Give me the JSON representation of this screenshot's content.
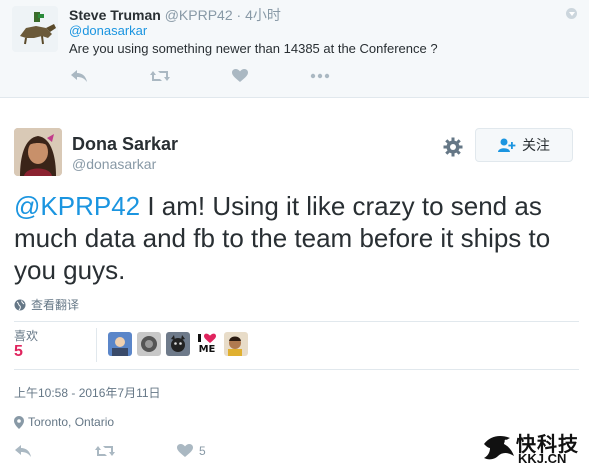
{
  "reply_tweet": {
    "name": "Steve Truman",
    "handle": "@KPRP42",
    "time": "4小时",
    "reply_to": "@donasarkar",
    "text": "Are you using something newer than 14385 at the Conference ?",
    "actions": [
      "reply-icon",
      "retweet-icon",
      "like-icon",
      "more-icon"
    ]
  },
  "main_tweet": {
    "display_name": "Dona Sarkar",
    "screen_name": "@donasarkar",
    "follow_label": "关注",
    "text_mention": "@KPRP42",
    "text_body": " I am! Using it like crazy to send as much data and fb to the team before it ships to you guys.",
    "translate_label": "查看翻译",
    "likes_label": "喜欢",
    "likes_count": "5",
    "liker_badge_text": "ME",
    "timestamp": "上午10:58 - 2016年7月11日",
    "location": "Toronto, Ontario",
    "footer_like_count": "5"
  },
  "watermark": {
    "brand": "快科技",
    "domain": "KKJ.CN"
  },
  "colors": {
    "link": "#1b95e0",
    "muted": "#8899a6",
    "like": "#e0245e",
    "text": "#292f33"
  }
}
